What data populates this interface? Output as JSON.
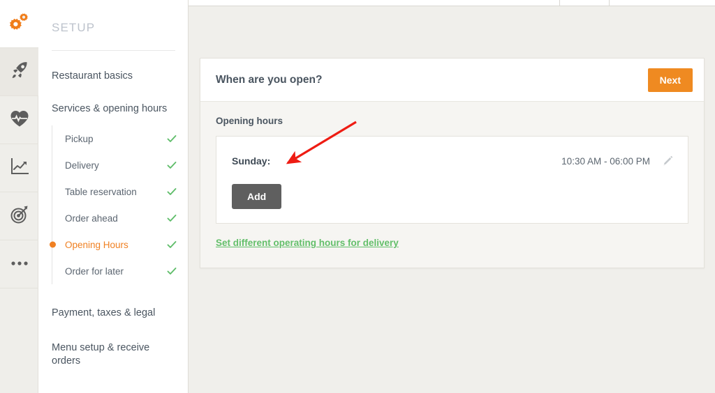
{
  "colors": {
    "accent_orange": "#f08022",
    "button_orange": "#ef8a21",
    "check_green": "#5fbd6a",
    "link_green": "#63bf6a",
    "add_gray": "#5f5f5f",
    "page_bg": "#f0efeb",
    "annotation_red": "#ee1c13"
  },
  "rail": {
    "items": [
      {
        "name": "gears-icon",
        "label": "Setup",
        "active": true
      },
      {
        "name": "rocket-icon",
        "label": "Getting started",
        "active": false
      },
      {
        "name": "heart-pulse-icon",
        "label": "Health",
        "active": false
      },
      {
        "name": "chart-line-icon",
        "label": "Statistics",
        "active": false
      },
      {
        "name": "target-icon",
        "label": "Marketing",
        "active": false
      },
      {
        "name": "more-dots-icon",
        "label": "More",
        "active": false
      }
    ]
  },
  "sidebar": {
    "title": "SETUP",
    "sections": [
      {
        "label": "Restaurant basics"
      },
      {
        "label": "Services & opening hours"
      }
    ],
    "subitems": [
      {
        "label": "Pickup",
        "checked": true,
        "active": false
      },
      {
        "label": "Delivery",
        "checked": true,
        "active": false
      },
      {
        "label": "Table reservation",
        "checked": true,
        "active": false
      },
      {
        "label": "Order ahead",
        "checked": true,
        "active": false
      },
      {
        "label": "Opening Hours",
        "checked": true,
        "active": true
      },
      {
        "label": "Order for later",
        "checked": true,
        "active": false
      }
    ],
    "footer_sections": [
      {
        "label": "Payment, taxes & legal"
      },
      {
        "label": "Menu setup & receive orders"
      }
    ]
  },
  "card": {
    "title": "When are you open?",
    "next_label": "Next",
    "section_label": "Opening hours",
    "hours": [
      {
        "day": "Sunday:",
        "time": "10:30 AM - 06:00 PM"
      }
    ],
    "add_label": "Add",
    "delivery_link": "Set different operating hours for delivery"
  }
}
